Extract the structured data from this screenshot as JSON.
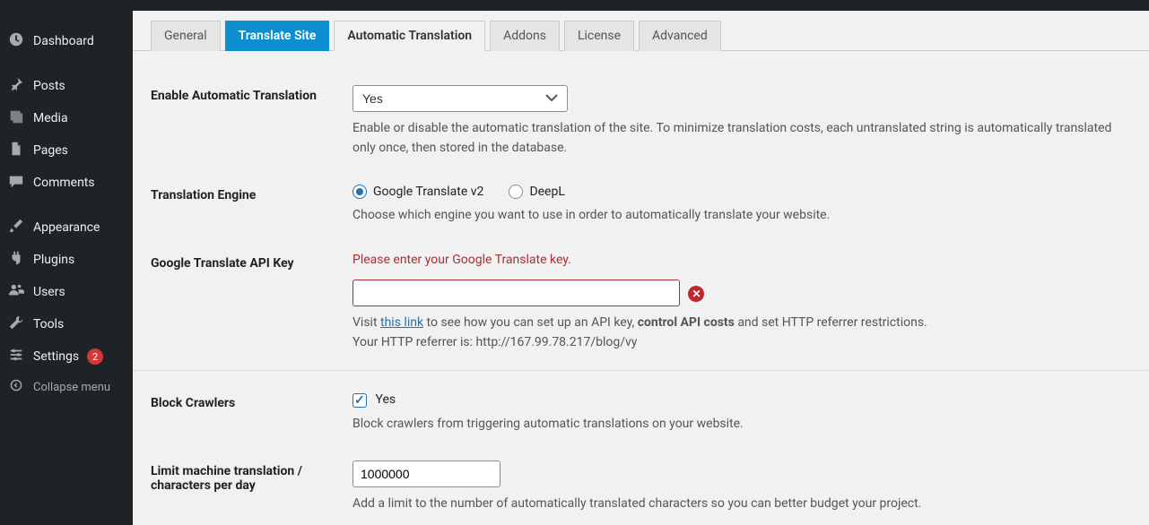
{
  "sidebar": {
    "items": [
      {
        "label": "Dashboard"
      },
      {
        "label": "Posts"
      },
      {
        "label": "Media"
      },
      {
        "label": "Pages"
      },
      {
        "label": "Comments"
      },
      {
        "label": "Appearance"
      },
      {
        "label": "Plugins"
      },
      {
        "label": "Users"
      },
      {
        "label": "Tools"
      },
      {
        "label": "Settings"
      }
    ],
    "settings_count": "2",
    "collapse": "Collapse menu"
  },
  "tabs": {
    "general": "General",
    "translate_site": "Translate Site",
    "automatic": "Automatic Translation",
    "addons": "Addons",
    "license": "License",
    "advanced": "Advanced"
  },
  "form": {
    "enable": {
      "label": "Enable Automatic Translation",
      "value": "Yes",
      "desc": "Enable or disable the automatic translation of the site. To minimize translation costs, each untranslated string is automatically translated only once, then stored in the database."
    },
    "engine": {
      "label": "Translation Engine",
      "opt_google": "Google Translate v2",
      "opt_deepl": "DeepL",
      "desc": "Choose which engine you want to use in order to automatically translate your website."
    },
    "gkey": {
      "label": "Google Translate API Key",
      "error": "Please enter your Google Translate key.",
      "visit_pre": "Visit ",
      "link_text": "this link",
      "visit_post": " to see how you can set up an API key, ",
      "bold": "control API costs",
      "tail": " and set HTTP referrer restrictions.",
      "referrer": "Your HTTP referrer is: http://167.99.78.217/blog/vy"
    },
    "block": {
      "label": "Block Crawlers",
      "yes": "Yes",
      "desc": "Block crawlers from triggering automatic translations on your website."
    },
    "limit": {
      "label": "Limit machine translation / characters per day",
      "value": "1000000",
      "desc": "Add a limit to the number of automatically translated characters so you can better budget your project."
    }
  }
}
